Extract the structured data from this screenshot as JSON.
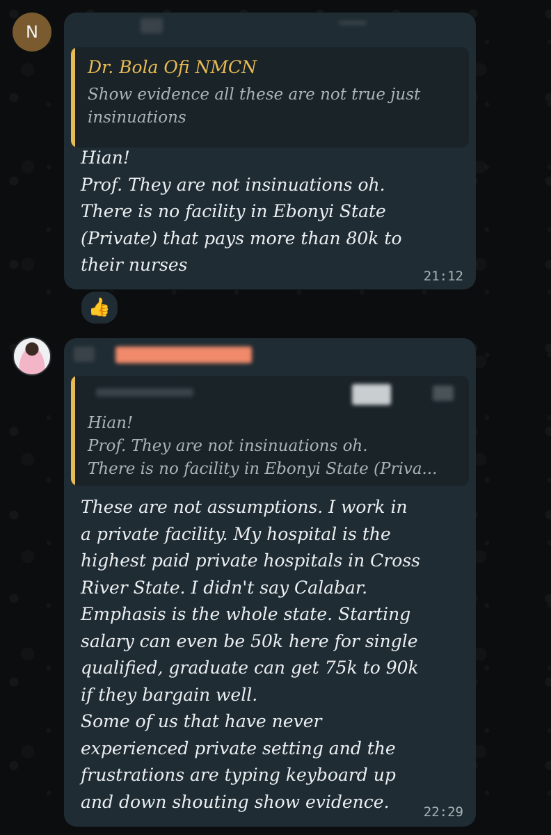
{
  "messages": [
    {
      "avatar_letter": "N",
      "quoted": {
        "author": "Dr. Bola Ofi NMCN",
        "text": "Show  evidence all these are not true just insinuations"
      },
      "text": "Hian!\nProf. They are not insinuations oh.\nThere is no facility in Ebonyi State\n(Private) that pays more than 80k to\ntheir nurses",
      "time": "21:12",
      "reaction": "👍"
    },
    {
      "quoted": {
        "text": "Hian!\nProf. They are not insinuations oh.\nThere is no facility in Ebonyi State (Priva..."
      },
      "text": "These are not assumptions. I work in\na private facility. My hospital is the\nhighest paid private hospitals in Cross\nRiver State. I didn't say Calabar.\nEmphasis is the whole state. Starting\nsalary can even be 50k here for single\nqualified, graduate can get 75k to 90k\nif they bargain well.\nSome of us that have never\nexperienced private setting and the\nfrustrations are typing keyboard up\nand down shouting show evidence.",
      "time": "22:29"
    }
  ],
  "colors": {
    "background": "#0b0d0e",
    "bubble": "#1f2c33",
    "quote_bar": "#e9bb53",
    "sender_redaction": "#f08a6a"
  },
  "icons": [
    "thumbs-up-reaction"
  ]
}
